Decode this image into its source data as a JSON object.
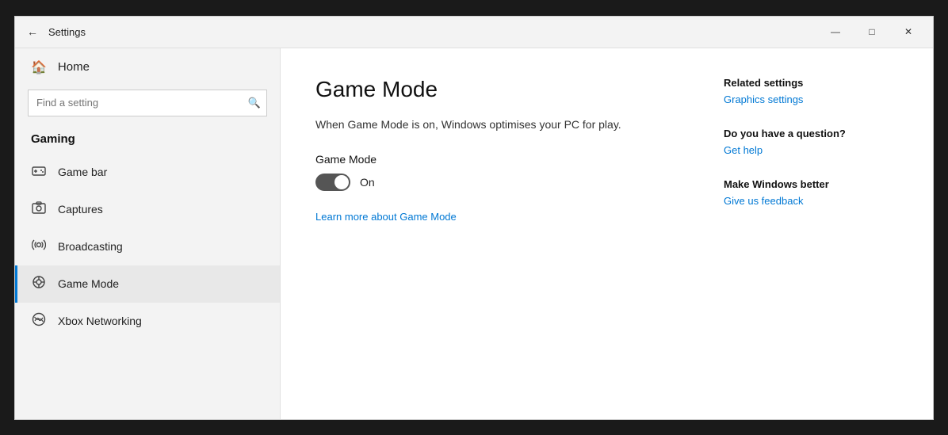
{
  "titlebar": {
    "back_label": "←",
    "title": "Settings",
    "minimize": "—",
    "maximize": "□",
    "close": "✕"
  },
  "sidebar": {
    "home_label": "Home",
    "search_placeholder": "Find a setting",
    "section_title": "Gaming",
    "items": [
      {
        "id": "game-bar",
        "label": "Game bar",
        "icon": "📊"
      },
      {
        "id": "captures",
        "label": "Captures",
        "icon": "📷"
      },
      {
        "id": "broadcasting",
        "label": "Broadcasting",
        "icon": "📡"
      },
      {
        "id": "game-mode",
        "label": "Game Mode",
        "icon": "⚙"
      },
      {
        "id": "xbox-networking",
        "label": "Xbox Networking",
        "icon": "🎮"
      }
    ]
  },
  "main": {
    "page_title": "Game Mode",
    "description": "When Game Mode is on, Windows optimises your PC for play.",
    "setting_label": "Game Mode",
    "toggle_state": "On",
    "learn_more": "Learn more about Game Mode"
  },
  "related": {
    "settings_heading": "Related settings",
    "settings_link": "Graphics settings",
    "question_heading": "Do you have a question?",
    "question_link": "Get help",
    "feedback_heading": "Make Windows better",
    "feedback_link": "Give us feedback"
  }
}
